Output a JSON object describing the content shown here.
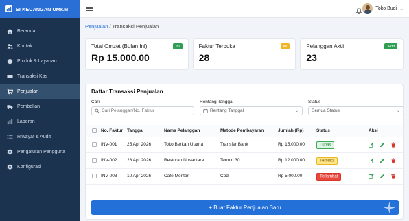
{
  "app": {
    "brand": "SI KEUANGAN UMKM"
  },
  "sidebar": {
    "items": [
      {
        "label": "Beranda",
        "icon": "home-icon"
      },
      {
        "label": "Kontak",
        "icon": "users-icon"
      },
      {
        "label": "Produk & Layanan",
        "icon": "box-icon"
      },
      {
        "label": "Transaksi Kas",
        "icon": "cash-icon"
      },
      {
        "label": "Penjualan",
        "icon": "cart-icon",
        "active": true
      },
      {
        "label": "Pembelian",
        "icon": "truck-icon"
      },
      {
        "label": "Laporan",
        "icon": "chart-icon"
      },
      {
        "label": "Riwayat & Audit",
        "icon": "list-icon"
      },
      {
        "label": "Pengaturan Pengguna",
        "icon": "gear-icon"
      },
      {
        "label": "Konfigurasi",
        "icon": "gear-icon"
      }
    ]
  },
  "topbar": {
    "user_name": "Toko Budi"
  },
  "breadcrumb": {
    "parent": "Penjualan",
    "separator": " / ",
    "current": "Transaksi Penjualan"
  },
  "cards": [
    {
      "label": "Total Omzet (Bulan Ini)",
      "value": "Rp 15.000.00",
      "badge": "Ini",
      "badge_color": "#2f9e52"
    },
    {
      "label": "Faktur Terbuka",
      "value": "28",
      "badge": "Ini",
      "badge_color": "#f0b429"
    },
    {
      "label": "Pelanggan Aktif",
      "value": "23",
      "badge": "Aktif",
      "badge_color": "#2f9e52"
    }
  ],
  "panel": {
    "title": "Daftar Transaksi Penjualan",
    "filters": {
      "search_label": "Cari",
      "search_placeholder": "Cari Pelanggan/No. Faktur",
      "date_label": "Rentang Tanggal",
      "date_value": "Rentang Tanggal",
      "status_label": "Status",
      "status_value": "Semua Status"
    },
    "columns": [
      "No. Faktur",
      "Tanggal",
      "Nama Pelanggan",
      "Metode Pembayaran",
      "Jumlah (Rp)",
      "Status",
      "Aksi"
    ],
    "rows": [
      {
        "faktur": "INV-001",
        "tanggal": "25 Apr 2026",
        "pelanggan": "Toko Berkah Utama",
        "metode": "Transfer Bank",
        "jumlah": "Rp 15.000.00",
        "status": "Lunas",
        "status_class": "s-lunas"
      },
      {
        "faktur": "INV-002",
        "tanggal": "28 Apr 2026",
        "pelanggan": "Restoran Nusantara",
        "metode": "Termin 30",
        "jumlah": "Rp 12.000.00",
        "status": "Terbuka",
        "status_class": "s-terbuka"
      },
      {
        "faktur": "INV-003",
        "tanggal": "10 Apr 2026",
        "pelanggan": "Cafe Mentari",
        "metode": "Cod",
        "jumlah": "Rp 5.000.00",
        "status": "Terlambat",
        "status_class": "s-terlambat"
      }
    ],
    "new_button": "+ Buat Faktur Penjualan Baru"
  },
  "colors": {
    "sidebar": "#1c3350",
    "accent": "#2a6fd6",
    "edit": "#2f9e52",
    "delete": "#d9362c"
  }
}
